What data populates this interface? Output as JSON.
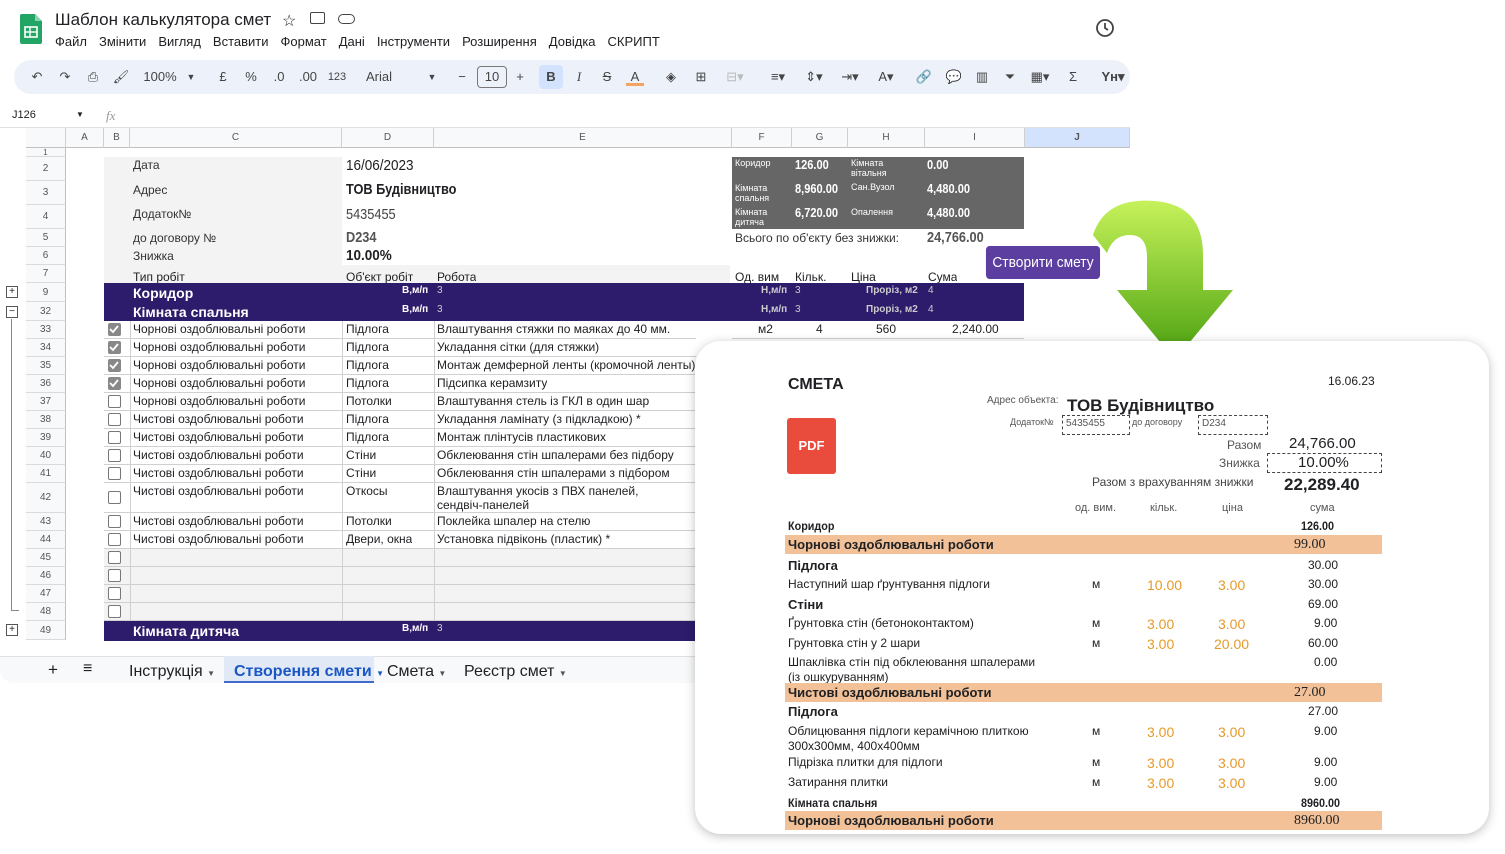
{
  "app": {
    "title": "Шаблон калькулятора смет",
    "menu": [
      "Файл",
      "Змінити",
      "Вигляд",
      "Вставити",
      "Формат",
      "Дані",
      "Інструменти",
      "Розширення",
      "Довідка",
      "СКРИПТ"
    ]
  },
  "toolbar": {
    "zoom": "100%",
    "currency": "£",
    "percent": "%",
    "dec_less": ".0",
    "dec_more": ".00",
    "fmt123": "123",
    "font": "Arial",
    "minus": "−",
    "size": "10",
    "plus": "+",
    "bold": "B",
    "italic": "I",
    "strike": "S",
    "textcolor": "A",
    "sigma": "Σ"
  },
  "namebox": "J126",
  "fx": "fx",
  "columns": [
    "A",
    "B",
    "C",
    "D",
    "E",
    "F",
    "G",
    "H",
    "I",
    "J"
  ],
  "rows": [
    "1",
    "2",
    "3",
    "4",
    "5",
    "6",
    "7",
    "9",
    "32",
    "33",
    "34",
    "35",
    "36",
    "37",
    "38",
    "39",
    "40",
    "41",
    "42",
    "43",
    "44",
    "45",
    "46",
    "47",
    "48",
    "49"
  ],
  "form": {
    "date_label": "Дата",
    "date": "16/06/2023",
    "addr_label": "Адрес",
    "addr": "ТОВ Будівництво",
    "add_label": "Додаток№",
    "add": "5435455",
    "contract_label": "до договору №",
    "contract": "D234",
    "disc_label": "Знижка",
    "disc": "10.00%"
  },
  "summary": {
    "r1": [
      "Коридор",
      "126.00",
      "Кімната вітальня",
      "0.00"
    ],
    "r2": [
      "Кімната спальня",
      "8,960.00",
      "Сан.Вузол",
      "4,480.00"
    ],
    "r3": [
      "Кімната дитяча",
      "6,720.00",
      "Опалення",
      "4,480.00"
    ],
    "total_label": "Всього по об'єкту без знижки:",
    "total": "24,766.00"
  },
  "headers": [
    "Тип робіт",
    "Об'єкт робіт",
    "Робота",
    "Од. вим",
    "Кільк.",
    "Ціна",
    "Сума"
  ],
  "bands": {
    "b1": {
      "name": "Коридор",
      "a": "В,м/п",
      "an": "3",
      "b": "Н,м/п",
      "bn": "3",
      "c": "Проріз, м2",
      "cn": "4"
    },
    "b2": {
      "name": "Кімната спальня",
      "a": "В,м/п",
      "an": "3",
      "b": "Н,м/п",
      "bn": "3",
      "c": "Проріз, м2",
      "cn": "4"
    },
    "b3": {
      "name": "Кімната дитяча",
      "a": "В,м/п",
      "an": "3"
    }
  },
  "first_row": {
    "unit": "м2",
    "qty": "4",
    "price": "560",
    "sum": "2,240.00"
  },
  "work": [
    {
      "t": "Чорнові оздоблювальні роботи",
      "o": "Підлога",
      "w": "Влаштування стяжки по маяках до 40 мм."
    },
    {
      "t": "Чорнові оздоблювальні роботи",
      "o": "Підлога",
      "w": "Укладання сітки (для стяжки)"
    },
    {
      "t": "Чорнові оздоблювальні роботи",
      "o": "Підлога",
      "w": "Монтаж демферной ленты (кромочной ленты)"
    },
    {
      "t": "Чорнові оздоблювальні роботи",
      "o": "Підлога",
      "w": "Підсипка керамзиту"
    },
    {
      "t": "Чорнові оздоблювальні роботи",
      "o": "Потолки",
      "w": "Влаштування стель із ГКЛ в один шар"
    },
    {
      "t": "Чистові оздоблювальні роботи",
      "o": "Підлога",
      "w": "Укладання ламінату (з підкладкою) *"
    },
    {
      "t": "Чистові оздоблювальні роботи",
      "o": "Підлога",
      "w": "Монтаж плінтусів пластикових"
    },
    {
      "t": "Чистові оздоблювальні роботи",
      "o": "Стіни",
      "w": "Обклеювання стін шпалерами без підбору"
    },
    {
      "t": "Чистові оздоблювальні роботи",
      "o": "Стіни",
      "w": "Обклеювання стін шпалерами з підбором"
    },
    {
      "t": "Чистові оздоблювальні роботи",
      "o": "Откосы",
      "w": "Влаштування укосів з ПВХ панелей,",
      "w2": "сендвіч-панелей"
    },
    {
      "t": "Чистові оздоблювальні роботи",
      "o": "Потолки",
      "w": "Поклейка шпалер на стелю"
    },
    {
      "t": "Чистові оздоблювальні роботи",
      "o": "Двери, окна",
      "w": "Установка підвіконь (пластик) *"
    }
  ],
  "button": "Створити смету",
  "tabs": [
    "+",
    "≡",
    "Інструкція",
    "Створення смети",
    "Смета",
    "Реєстр смет"
  ],
  "est": {
    "title": "СМЕТА",
    "date": "16.06.23",
    "obj_label": "Адрес объекта:",
    "obj": "ТОВ Будівництво",
    "add_label": "Додаток№",
    "add": "5435455",
    "contract_label": "до договору",
    "contract": "D234",
    "pdf": "PDF",
    "total_label": "Разом",
    "total": "24,766.00",
    "disc_label": "Знижка",
    "disc": "10.00%",
    "final_label": "Разом з врахуванням знижки",
    "final": "22,289.40",
    "cols": [
      "од. вим.",
      "кільк.",
      "ціна",
      "сума"
    ],
    "lines": [
      {
        "k": "room",
        "n": "Коридор",
        "s": "126.00"
      },
      {
        "k": "cat",
        "n": "Чорнові оздоблювальні роботи",
        "s": "99.00"
      },
      {
        "k": "obj",
        "n": "Підлога",
        "s": "30.00"
      },
      {
        "k": "item",
        "n": "Наступний шар ґрунтування підлоги",
        "u": "м",
        "q": "10.00",
        "p": "3.00",
        "s": "30.00"
      },
      {
        "k": "obj",
        "n": "Стіни",
        "s": "69.00"
      },
      {
        "k": "item",
        "n": "Ґрунтовка стін (бетоноконтактом)",
        "u": "м",
        "q": "3.00",
        "p": "3.00",
        "s": "9.00"
      },
      {
        "k": "item",
        "n": "Грунтовка стін у 2 шари",
        "u": "м",
        "q": "3.00",
        "p": "20.00",
        "s": "60.00"
      },
      {
        "k": "item2",
        "n": "Шпаклівка стін під обклеювання шпалерами",
        "n2": "(із ошкуруванням)",
        "s": "0.00"
      },
      {
        "k": "cat",
        "n": "Чистові оздоблювальні роботи",
        "s": "27.00"
      },
      {
        "k": "obj",
        "n": "Підлога",
        "s": "27.00"
      },
      {
        "k": "item2",
        "n": "Облицювання підлоги керамічною плиткою",
        "n2": "300x300мм, 400x400мм",
        "u": "м",
        "q": "3.00",
        "p": "3.00",
        "s": "9.00"
      },
      {
        "k": "item",
        "n": "Підрізка плитки для підлоги",
        "u": "м",
        "q": "3.00",
        "p": "3.00",
        "s": "9.00"
      },
      {
        "k": "item",
        "n": "Затирання плитки",
        "u": "м",
        "q": "3.00",
        "p": "3.00",
        "s": "9.00"
      },
      {
        "k": "room",
        "n": "Кімната спальня",
        "s": "8960.00"
      },
      {
        "k": "cat",
        "n": "Чорнові оздоблювальні роботи",
        "s": "8960.00"
      }
    ]
  },
  "colors": {
    "band": "#2d1b6b",
    "dark": "#666666",
    "accent": "#f2c197",
    "orange": "#e69a2a",
    "button": "#5b3ea0",
    "arrow": "#7cc41e"
  }
}
